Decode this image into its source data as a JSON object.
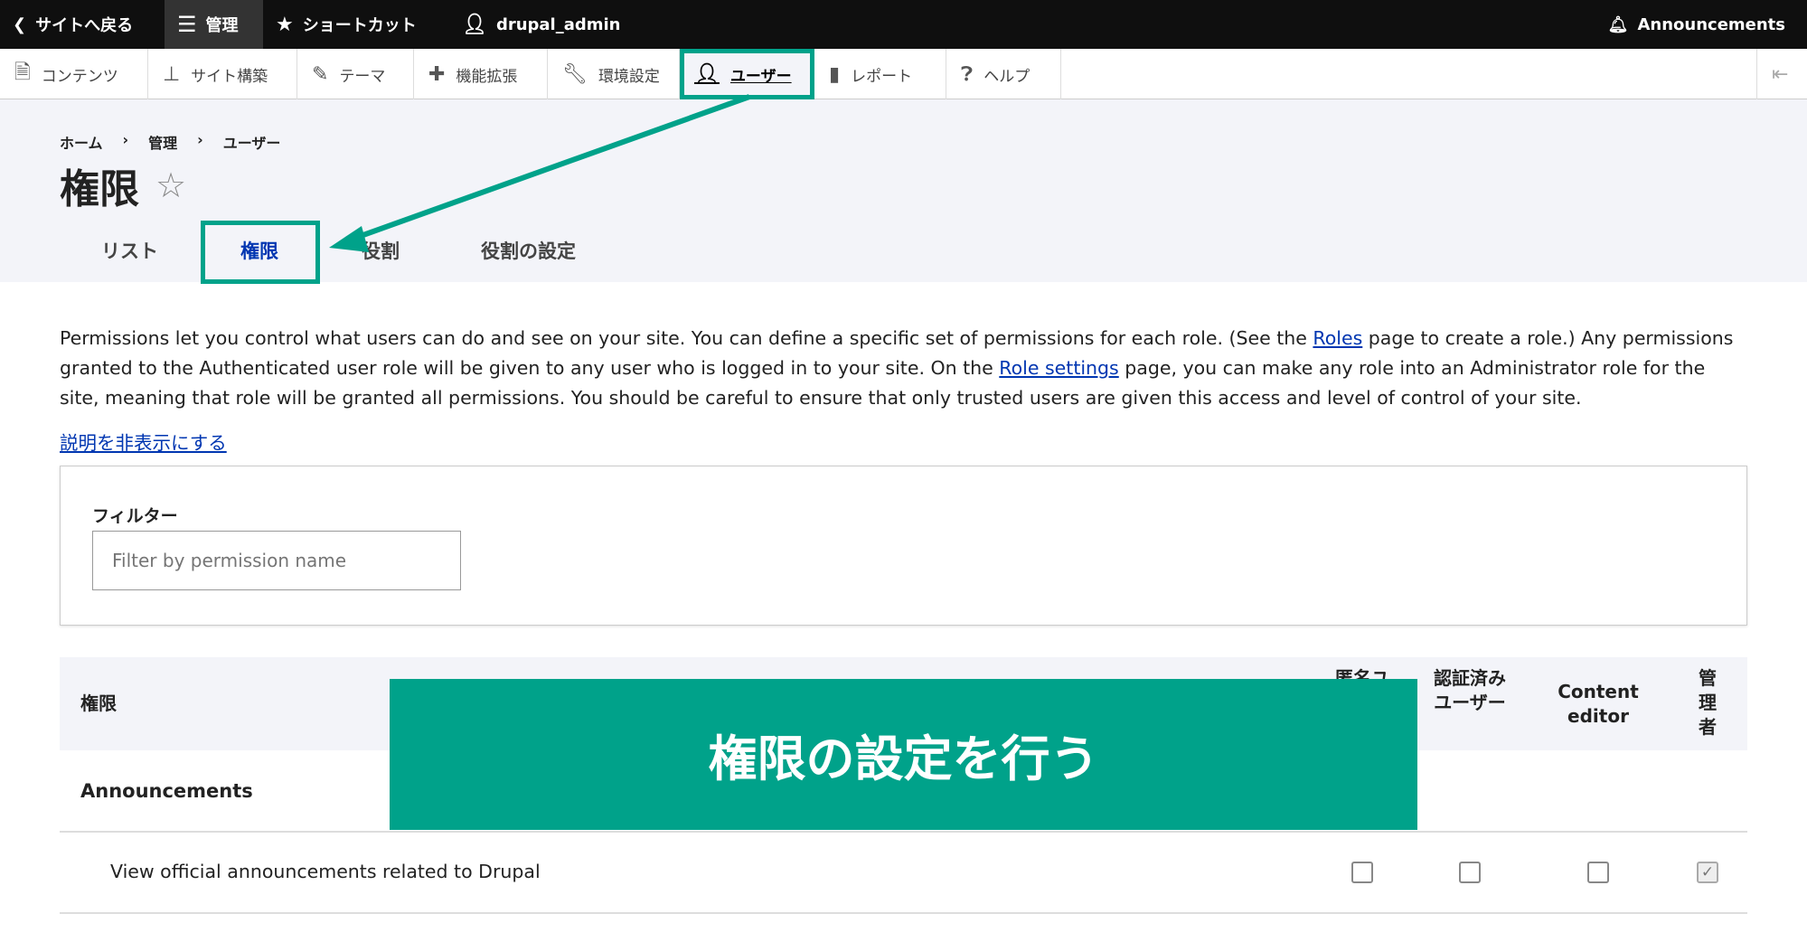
{
  "toolbar": {
    "back": "サイトへ戻る",
    "manage": "管理",
    "shortcuts": "ショートカット",
    "user": "drupal_admin",
    "announcements": "Announcements"
  },
  "menu": [
    "コンテンツ",
    "サイト構築",
    "テーマ",
    "機能拡張",
    "環境設定",
    "ユーザー",
    "レポート",
    "ヘルプ"
  ],
  "breadcrumb": [
    "ホーム",
    "管理",
    "ユーザー"
  ],
  "page_title": "権限",
  "tabs": [
    "リスト",
    "権限",
    "役割",
    "役割の設定"
  ],
  "description": {
    "p1": "Permissions let you control what users can do and see on your site. You can define a specific set of permissions for each role. (See the ",
    "roles_link": "Roles",
    "p2": " page to create a role.) Any permissions granted to the Authenticated user role will be given to any user who is logged in to your site. On the ",
    "role_settings_link": "Role settings",
    "p3": " page, you can make any role into an Administrator role for the site, meaning that role will be granted all permissions. You should be careful to ensure that only trusted users are given this access and level of control of your site."
  },
  "hide_description": "説明を非表示にする",
  "filter": {
    "label": "フィルター",
    "placeholder": "Filter by permission name"
  },
  "table": {
    "headers": [
      "権限",
      "匿名ユーザー",
      "認証済みユーザー",
      "Content editor",
      "管理者"
    ],
    "group": "Announcements",
    "rows": [
      {
        "label": "View official announcements related to Drupal",
        "checked": [
          false,
          false,
          false,
          true
        ]
      }
    ]
  },
  "overlay": "権限の設定を行う",
  "colors": {
    "accent": "#00a28a",
    "link": "#0036b1"
  }
}
